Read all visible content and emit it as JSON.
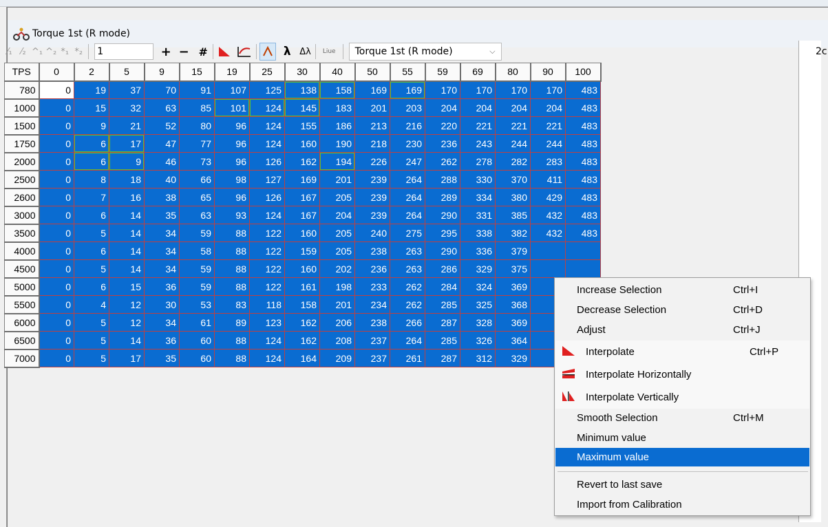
{
  "window": {
    "title": "Torque 1st (R mode)",
    "right_panel_text": "2c"
  },
  "toolbar": {
    "input_value": "1",
    "plus": "+",
    "minus": "−",
    "hash": "#",
    "lambda": "λ",
    "delta_lambda": "Δλ",
    "live": "Liue",
    "combo_value": "Torque 1st (R mode)"
  },
  "table": {
    "corner": "TPS",
    "columns": [
      "0",
      "2",
      "5",
      "9",
      "15",
      "19",
      "25",
      "30",
      "40",
      "50",
      "55",
      "59",
      "69",
      "80",
      "90",
      "100"
    ],
    "rows": [
      {
        "rpm": "780",
        "values": [
          "0",
          "19",
          "37",
          "70",
          "91",
          "107",
          "125",
          "138",
          "158",
          "169",
          "169",
          "170",
          "170",
          "170",
          "170",
          "483"
        ]
      },
      {
        "rpm": "1000",
        "values": [
          "0",
          "15",
          "32",
          "63",
          "85",
          "101",
          "124",
          "145",
          "183",
          "201",
          "203",
          "204",
          "204",
          "204",
          "204",
          "483"
        ]
      },
      {
        "rpm": "1500",
        "values": [
          "0",
          "9",
          "21",
          "52",
          "80",
          "96",
          "124",
          "155",
          "186",
          "213",
          "216",
          "220",
          "221",
          "221",
          "221",
          "483"
        ]
      },
      {
        "rpm": "1750",
        "values": [
          "0",
          "6",
          "17",
          "47",
          "77",
          "96",
          "124",
          "160",
          "190",
          "218",
          "230",
          "236",
          "243",
          "244",
          "244",
          "483"
        ]
      },
      {
        "rpm": "2000",
        "values": [
          "0",
          "6",
          "9",
          "46",
          "73",
          "96",
          "126",
          "162",
          "194",
          "226",
          "247",
          "262",
          "278",
          "282",
          "283",
          "483"
        ]
      },
      {
        "rpm": "2500",
        "values": [
          "0",
          "8",
          "18",
          "40",
          "66",
          "98",
          "127",
          "169",
          "201",
          "239",
          "264",
          "288",
          "330",
          "370",
          "411",
          "483"
        ]
      },
      {
        "rpm": "2600",
        "values": [
          "0",
          "7",
          "16",
          "38",
          "65",
          "96",
          "126",
          "167",
          "205",
          "239",
          "264",
          "289",
          "334",
          "380",
          "429",
          "483"
        ]
      },
      {
        "rpm": "3000",
        "values": [
          "0",
          "6",
          "14",
          "35",
          "63",
          "93",
          "124",
          "167",
          "204",
          "239",
          "264",
          "290",
          "331",
          "385",
          "432",
          "483"
        ]
      },
      {
        "rpm": "3500",
        "values": [
          "0",
          "5",
          "14",
          "34",
          "59",
          "88",
          "122",
          "160",
          "205",
          "240",
          "275",
          "295",
          "338",
          "382",
          "432",
          "483"
        ]
      },
      {
        "rpm": "4000",
        "values": [
          "0",
          "6",
          "14",
          "34",
          "58",
          "88",
          "122",
          "159",
          "205",
          "238",
          "263",
          "290",
          "336",
          "379",
          "",
          ""
        ]
      },
      {
        "rpm": "4500",
        "values": [
          "0",
          "5",
          "14",
          "34",
          "59",
          "88",
          "122",
          "160",
          "202",
          "236",
          "263",
          "286",
          "329",
          "375",
          "",
          ""
        ]
      },
      {
        "rpm": "5000",
        "values": [
          "0",
          "6",
          "15",
          "36",
          "59",
          "88",
          "122",
          "161",
          "198",
          "233",
          "262",
          "284",
          "324",
          "369",
          "",
          ""
        ]
      },
      {
        "rpm": "5500",
        "values": [
          "0",
          "4",
          "12",
          "30",
          "53",
          "83",
          "118",
          "158",
          "201",
          "234",
          "262",
          "285",
          "325",
          "368",
          "",
          ""
        ]
      },
      {
        "rpm": "6000",
        "values": [
          "0",
          "5",
          "12",
          "34",
          "61",
          "89",
          "123",
          "162",
          "206",
          "238",
          "266",
          "287",
          "328",
          "369",
          "",
          ""
        ]
      },
      {
        "rpm": "6500",
        "values": [
          "0",
          "5",
          "14",
          "36",
          "60",
          "88",
          "124",
          "162",
          "208",
          "237",
          "264",
          "285",
          "326",
          "364",
          "",
          ""
        ]
      },
      {
        "rpm": "7000",
        "values": [
          "0",
          "5",
          "17",
          "35",
          "60",
          "88",
          "124",
          "164",
          "209",
          "237",
          "261",
          "287",
          "312",
          "329",
          "",
          ""
        ]
      }
    ]
  },
  "context_menu": {
    "increase": {
      "label": "Increase Selection",
      "shortcut": "Ctrl+I"
    },
    "decrease": {
      "label": "Decrease Selection",
      "shortcut": "Ctrl+D"
    },
    "adjust": {
      "label": "Adjust",
      "shortcut": "Ctrl+J"
    },
    "interpolate": {
      "label": "Interpolate",
      "shortcut": "Ctrl+P"
    },
    "interp_h": {
      "label": "Interpolate Horizontally"
    },
    "interp_v": {
      "label": "Interpolate Vertically"
    },
    "smooth": {
      "label": "Smooth Selection",
      "shortcut": "Ctrl+M"
    },
    "minimum": {
      "label": "Minimum value"
    },
    "maximum": {
      "label": "Maximum value"
    },
    "revert": {
      "label": "Revert to last save"
    },
    "import": {
      "label": "Import from Calibration"
    }
  },
  "colors": {
    "cell_bg": "#0a6cd1",
    "cell_border": "#c04040",
    "menu_highlight": "#0a6cd1",
    "green_outline": "#58c03a"
  }
}
